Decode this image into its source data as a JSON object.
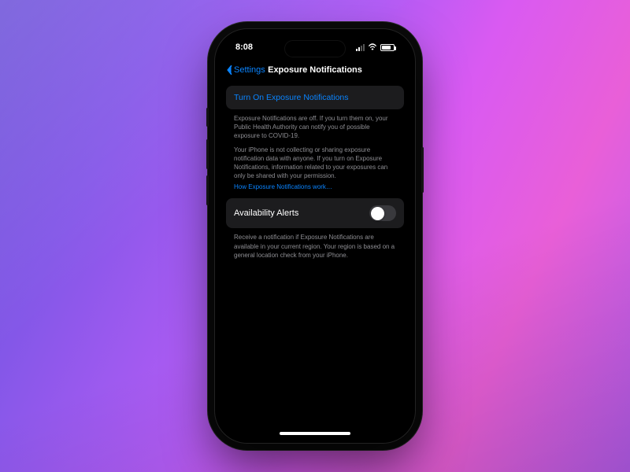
{
  "status": {
    "time": "8:08"
  },
  "nav": {
    "back_label": "Settings",
    "title": "Exposure Notifications"
  },
  "turn_on": {
    "label": "Turn On Exposure Notifications"
  },
  "description": {
    "p1": "Exposure Notifications are off. If you turn them on, your Public Health Authority can notify you of possible exposure to COVID-19.",
    "p2": "Your iPhone is not collecting or sharing exposure notification data with anyone. If you turn on Exposure Notifications, information related to your exposures can only be shared with your permission."
  },
  "link": {
    "how_it_works": "How Exposure Notifications work…"
  },
  "availability": {
    "label": "Availability Alerts",
    "toggle_on": false,
    "footer": "Receive a notification if Exposure Notifications are available in your current region. Your region is based on a general location check from your iPhone."
  }
}
